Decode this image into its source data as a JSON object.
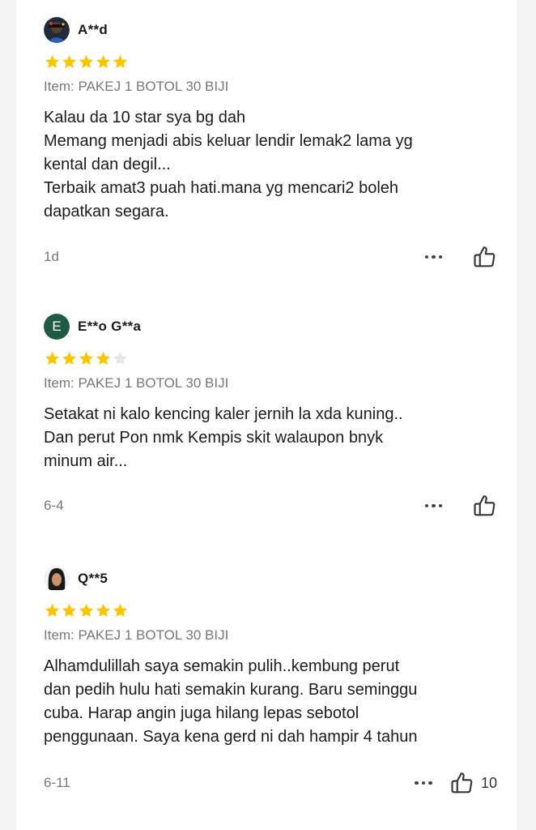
{
  "reviews": [
    {
      "username": "A**d",
      "rating": 5,
      "item": "Item: PAKEJ 1 BOTOL 30 BIJI",
      "text": "Kalau da 10 star sya bg dah\nMemang menjadi abis keluar lendir lemak2 lama yg\nkental dan degil...\nTerbaik amat3 puah hati.mana yg mencari2 boleh\ndapatkan segara.",
      "date": "1d",
      "likes": ""
    },
    {
      "username": "E**o G**a",
      "avatar_letter": "E",
      "rating": 4,
      "item": "Item: PAKEJ 1 BOTOL 30 BIJI",
      "text": "Setakat ni kalo kencing kaler jernih la xda kuning..\nDan perut Pon nmk Kempis skit walaupon bnyk\nminum air...",
      "date": "6-4",
      "likes": ""
    },
    {
      "username": "Q**5",
      "rating": 5,
      "item": "Item: PAKEJ 1 BOTOL 30 BIJI",
      "text": "Alhamdulillah saya semakin pulih..kembung perut\ndan pedih hulu hati semakin kurang. Baru seminggu\ncuba. Harap angin juga hilang lepas sebotol\npenggunaan. Saya kena gerd ni dah hampir 4 tahun",
      "date": "6-11",
      "likes": "10"
    }
  ],
  "colors": {
    "star_filled": "#f7c600",
    "star_empty": "#e6e6e6",
    "avatar_letter_bg": "#1f5b45"
  },
  "icons": {
    "more": "more-options-icon",
    "like": "thumbs-up-icon",
    "star": "star-icon"
  }
}
